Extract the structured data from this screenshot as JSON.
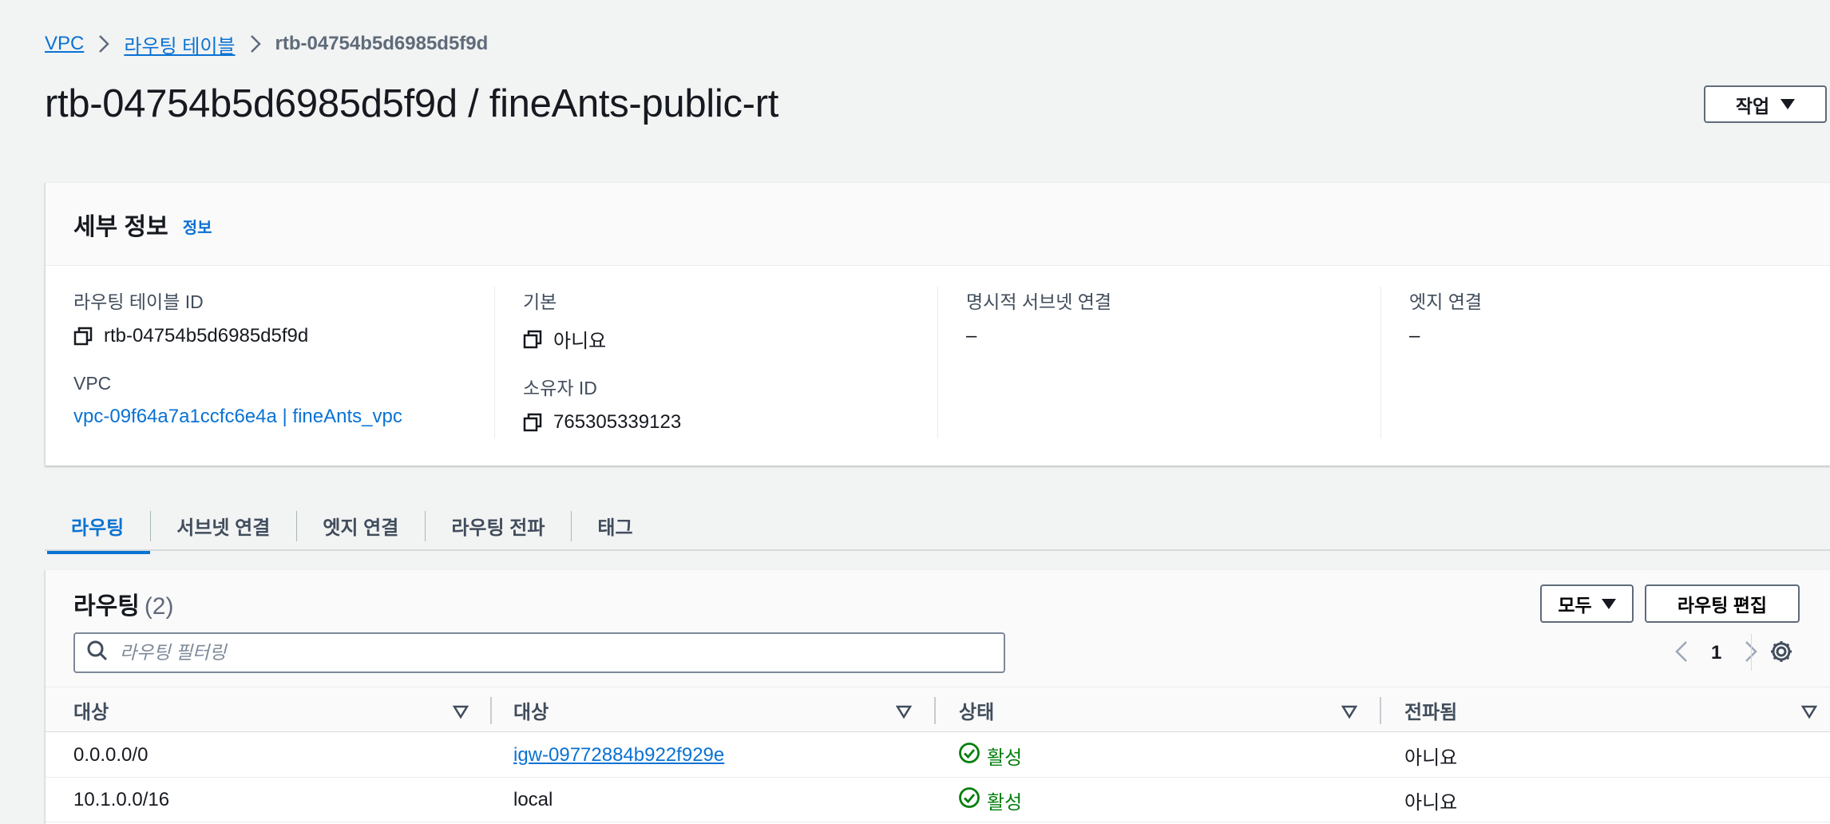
{
  "breadcrumb": {
    "items": [
      {
        "label": "VPC",
        "link": true
      },
      {
        "label": "라우팅 테이블",
        "link": true
      },
      {
        "label": "rtb-04754b5d6985d5f9d",
        "link": false
      }
    ]
  },
  "header": {
    "title": "rtb-04754b5d6985d5f9d / fineAnts-public-rt",
    "action_label": "작업"
  },
  "details": {
    "title": "세부 정보",
    "info_label": "정보",
    "fields": {
      "route_table_id": {
        "label": "라우팅 테이블 ID",
        "value": "rtb-04754b5d6985d5f9d"
      },
      "main": {
        "label": "기본",
        "value": "아니요"
      },
      "explicit_subnet": {
        "label": "명시적 서브넷 연결",
        "value": "–"
      },
      "edge": {
        "label": "엣지 연결",
        "value": "–"
      },
      "vpc": {
        "label": "VPC",
        "value": "vpc-09f64a7a1ccfc6e4a | fineAnts_vpc"
      },
      "owner": {
        "label": "소유자 ID",
        "value": "765305339123"
      }
    }
  },
  "tabs": [
    {
      "label": "라우팅",
      "active": true
    },
    {
      "label": "서브넷 연결",
      "active": false
    },
    {
      "label": "엣지 연결",
      "active": false
    },
    {
      "label": "라우팅 전파",
      "active": false
    },
    {
      "label": "태그",
      "active": false
    }
  ],
  "routes": {
    "title": "라우팅",
    "count": "(2)",
    "filter_select_label": "모두",
    "edit_label": "라우팅 편집",
    "search_placeholder": "라우팅 필터링",
    "page": "1",
    "columns": [
      "대상",
      "대상",
      "상태",
      "전파됨"
    ],
    "rows": [
      {
        "destination": "0.0.0.0/0",
        "target": "igw-09772884b922f929e",
        "target_link": true,
        "status": "활성",
        "propagated": "아니요"
      },
      {
        "destination": "10.1.0.0/16",
        "target": "local",
        "target_link": false,
        "status": "활성",
        "propagated": "아니요"
      }
    ]
  },
  "colors": {
    "link": "#0972d3",
    "success": "#037f0c",
    "background": "#f2f3f3"
  },
  "icons": {
    "copy": "copy-icon",
    "search": "search-icon",
    "settings": "gear-icon",
    "sort": "sort-caret-icon",
    "status": "check-circle-icon"
  }
}
